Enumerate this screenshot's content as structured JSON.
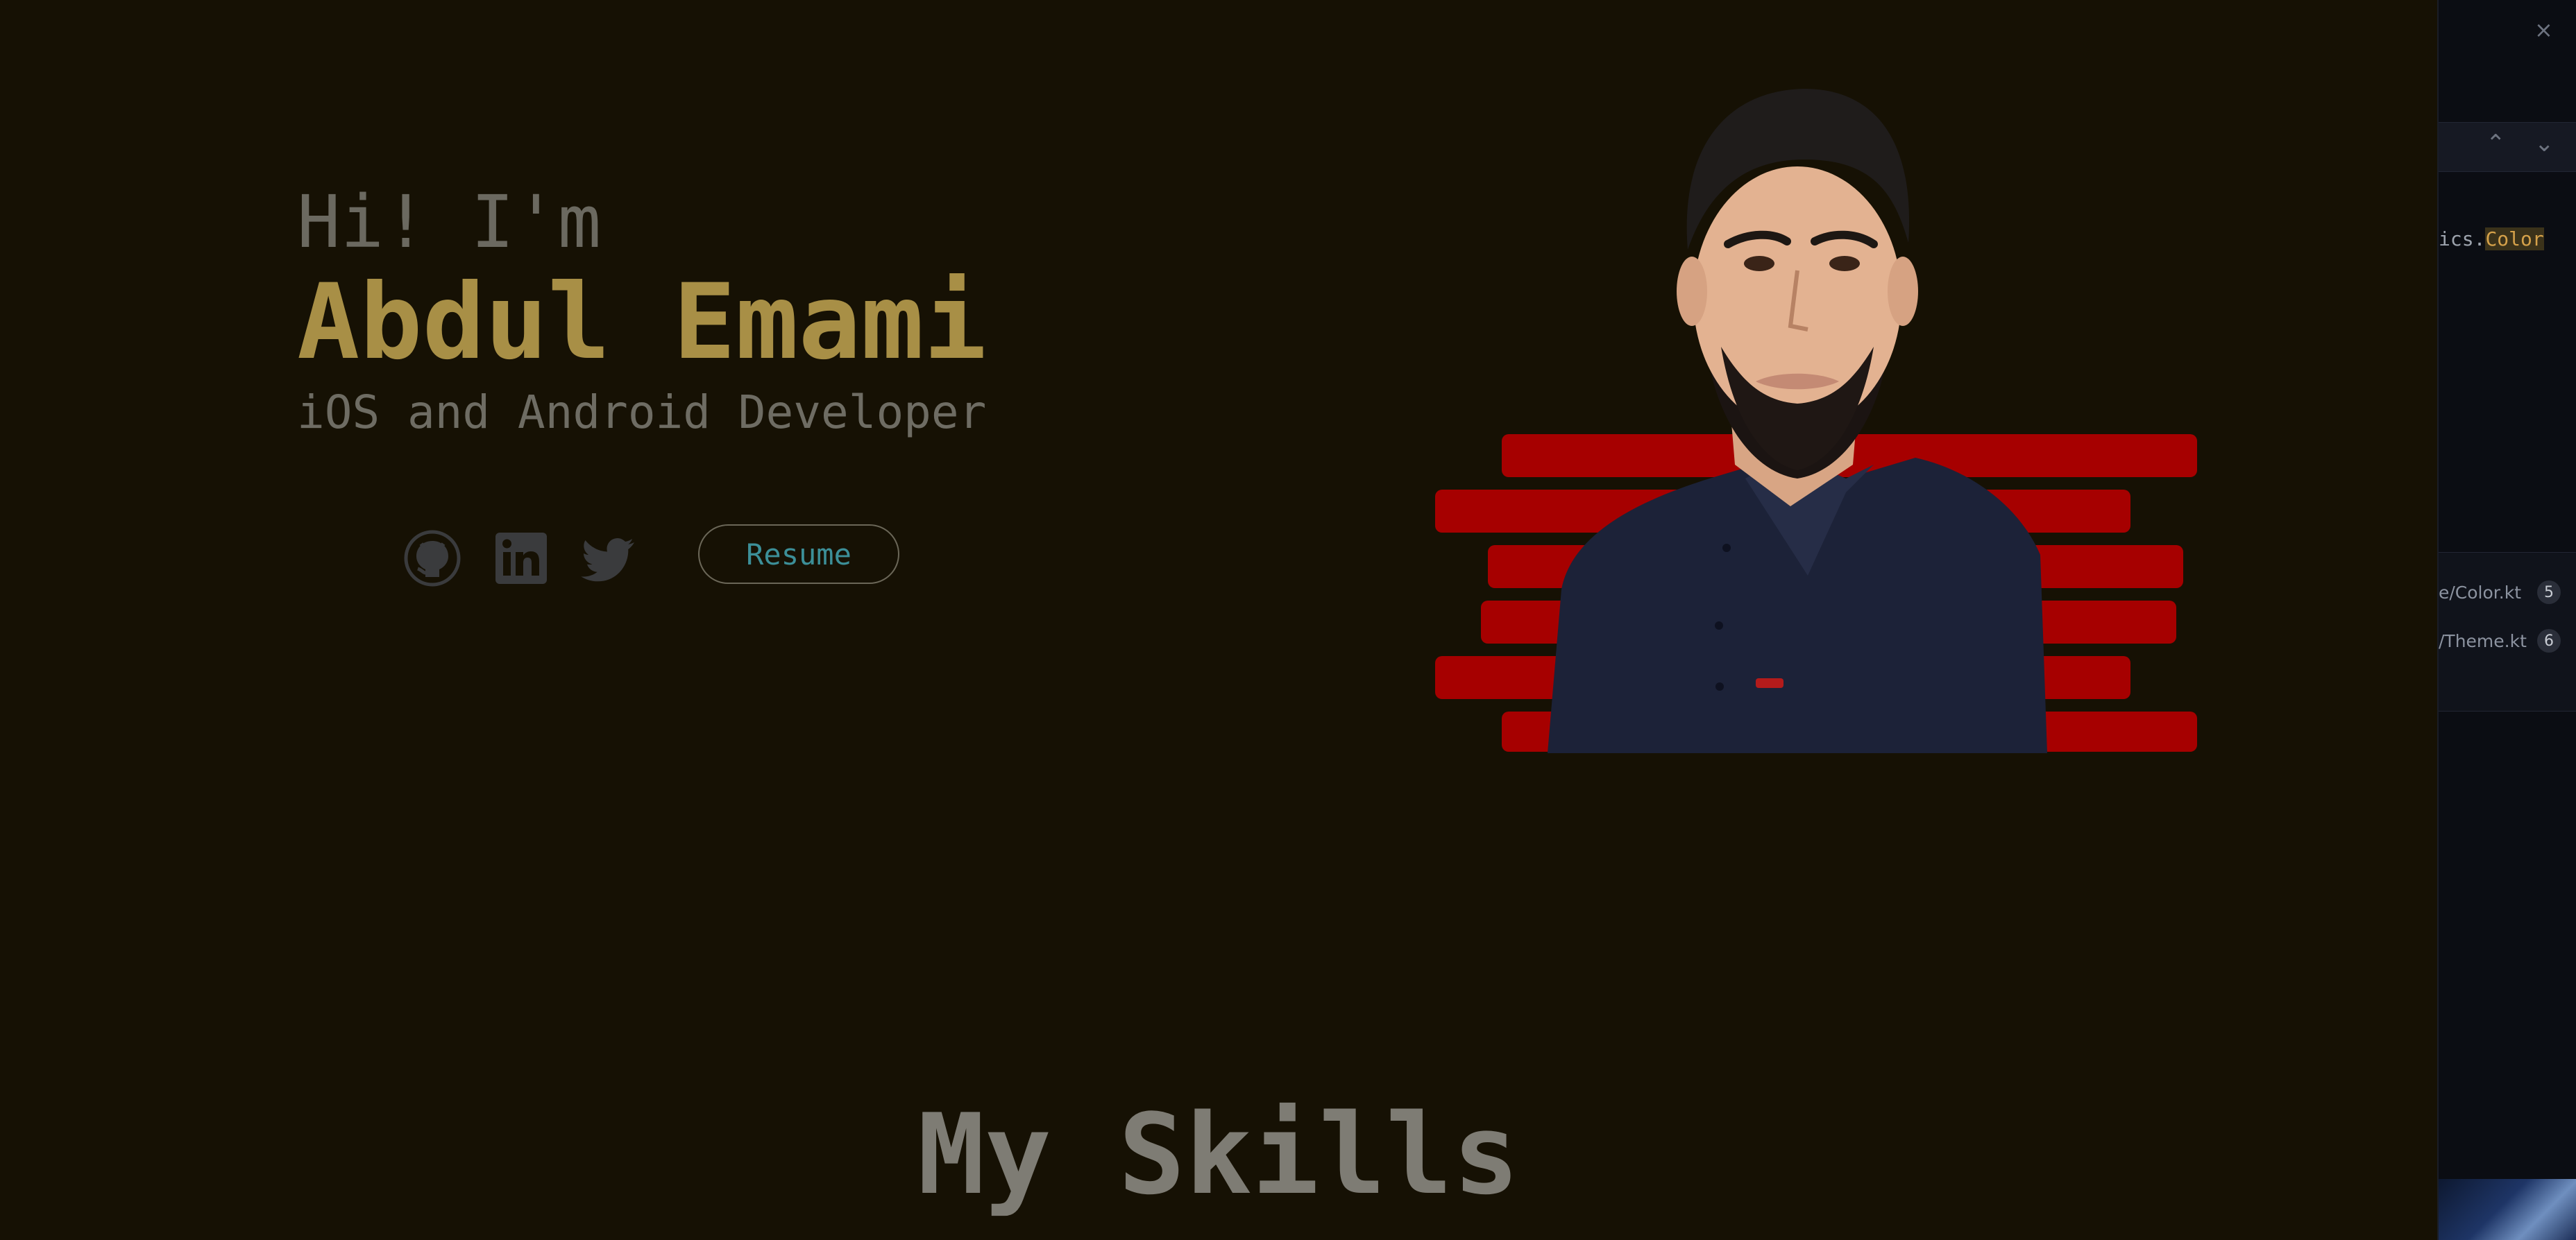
{
  "hero": {
    "greeting": "Hi! I'm",
    "name": "Abdul Emami",
    "role": "iOS and Android Developer",
    "resume_label": "Resume",
    "social_icons": [
      "github-icon",
      "linkedin-icon",
      "twitter-icon"
    ]
  },
  "skills": {
    "title": "My Skills"
  },
  "side_panel": {
    "close_glyph": "×",
    "up_glyph": "⌃",
    "down_glyph": "⌄",
    "code_prefix": "ics.",
    "code_highlight": "Color",
    "files": [
      {
        "name": "e/Color.kt",
        "count": "5"
      },
      {
        "name": "/Theme.kt",
        "count": "6"
      }
    ]
  },
  "colors": {
    "background": "#161104",
    "accent_name": "#a88f46",
    "resume_text": "#3c8f98",
    "stripe_red": "#a60000",
    "shirt_navy": "#1c2238"
  }
}
